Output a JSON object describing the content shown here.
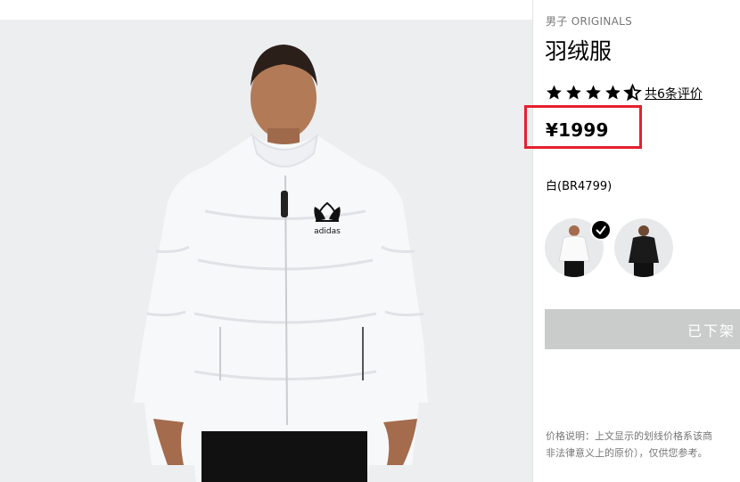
{
  "product": {
    "breadcrumb": "男子 ORIGINALS",
    "name": "羽绒服",
    "rating": 4.5,
    "rating_max": 5,
    "reviews_label": "共6条评价",
    "price": "¥1999",
    "color_label": "白(BR4799)",
    "swatches": [
      {
        "color": "white",
        "selected": true
      },
      {
        "color": "black",
        "selected": false
      }
    ],
    "sold_out_label": "已下架",
    "price_note": [
      "价格说明：上文显示的划线价格系该商",
      "非法律意义上的原价），仅供您参考。"
    ]
  },
  "main_image": {
    "logo_text": "adidas"
  },
  "colors": {
    "highlight_border": "#e5202e",
    "sold_out_bg": "#c9cccb",
    "gallery_bg": "#eceef0"
  }
}
